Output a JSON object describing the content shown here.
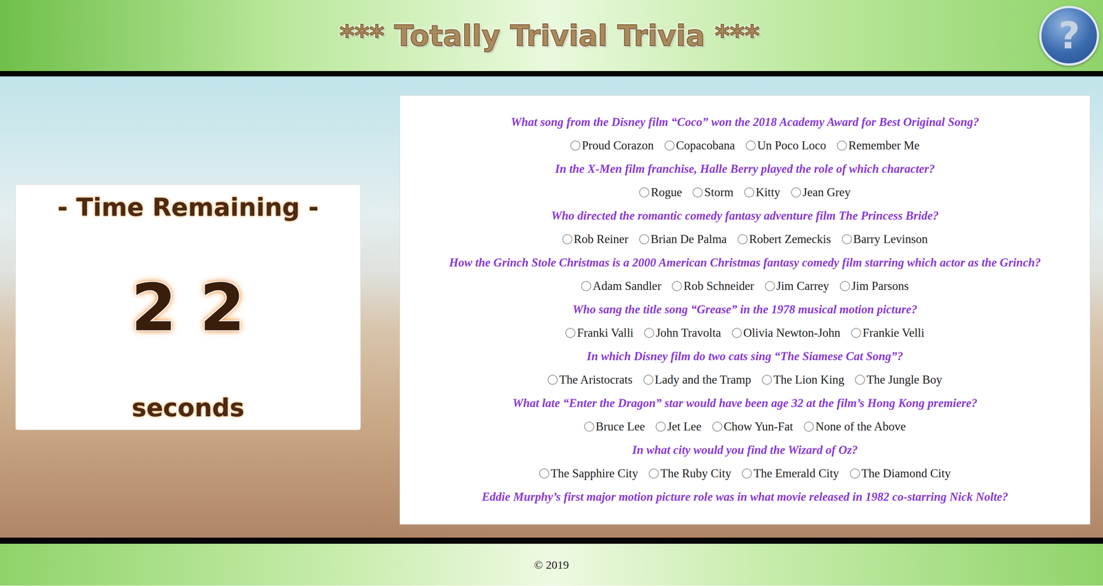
{
  "header": {
    "title": "*** Totally Trivial Trivia ***",
    "help_button": "?"
  },
  "timer": {
    "label": "- Time Remaining -",
    "digits": [
      "2",
      "2"
    ],
    "unit": "seconds"
  },
  "questions": [
    {
      "text": "What song from the Disney film “Coco” won the 2018 Academy Award for Best Original Song?",
      "options": [
        {
          "label": "Proud Corazon",
          "selected": false
        },
        {
          "label": "Copacobana",
          "selected": false
        },
        {
          "label": "Un Poco Loco",
          "selected": false
        },
        {
          "label": "Remember Me",
          "selected": false
        }
      ]
    },
    {
      "text": "In the X-Men film franchise, Halle Berry played the role of which character?",
      "options": [
        {
          "label": "Rogue",
          "selected": false
        },
        {
          "label": "Storm",
          "selected": false
        },
        {
          "label": "Kitty",
          "selected": false
        },
        {
          "label": "Jean Grey",
          "selected": false
        }
      ]
    },
    {
      "text": "Who directed the romantic comedy fantasy adventure film The Princess Bride?",
      "options": [
        {
          "label": "Rob Reiner",
          "selected": false
        },
        {
          "label": "Brian De Palma",
          "selected": false
        },
        {
          "label": "Robert Zemeckis",
          "selected": false
        },
        {
          "label": "Barry Levinson",
          "selected": false
        }
      ]
    },
    {
      "text": "How the Grinch Stole Christmas is a 2000 American Christmas fantasy comedy film starring which actor as the Grinch?",
      "options": [
        {
          "label": "Adam Sandler",
          "selected": false
        },
        {
          "label": "Rob Schneider",
          "selected": false
        },
        {
          "label": "Jim Carrey",
          "selected": false
        },
        {
          "label": "Jim Parsons",
          "selected": false
        }
      ]
    },
    {
      "text": "Who sang the title song “Grease” in the 1978 musical motion picture?",
      "options": [
        {
          "label": "Franki Valli",
          "selected": false
        },
        {
          "label": "John Travolta",
          "selected": false
        },
        {
          "label": "Olivia Newton-John",
          "selected": false
        },
        {
          "label": "Frankie Velli",
          "selected": false
        }
      ]
    },
    {
      "text": "In which Disney film do two cats sing “The Siamese Cat Song”?",
      "options": [
        {
          "label": "The Aristocrats",
          "selected": false
        },
        {
          "label": "Lady and the Tramp",
          "selected": false
        },
        {
          "label": "The Lion King",
          "selected": false
        },
        {
          "label": "The Jungle Boy",
          "selected": false
        }
      ]
    },
    {
      "text": "What late “Enter the Dragon” star would have been age 32 at the film’s Hong Kong premiere?",
      "options": [
        {
          "label": "Bruce Lee",
          "selected": false
        },
        {
          "label": "Jet Lee",
          "selected": false
        },
        {
          "label": "Chow Yun-Fat",
          "selected": false
        },
        {
          "label": "None of the Above",
          "selected": false
        }
      ]
    },
    {
      "text": "In what city would you find the Wizard of Oz?",
      "options": [
        {
          "label": "The Sapphire City",
          "selected": false
        },
        {
          "label": "The Ruby City",
          "selected": false
        },
        {
          "label": "The Emerald City",
          "selected": false
        },
        {
          "label": "The Diamond City",
          "selected": false
        }
      ]
    },
    {
      "text": "Eddie Murphy’s first major motion picture role was in what movie released in 1982 co-starring Nick Nolte?",
      "options": []
    }
  ],
  "footer": {
    "text": "© 2019"
  }
}
